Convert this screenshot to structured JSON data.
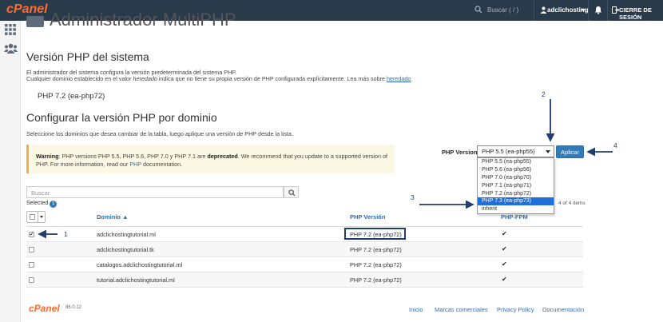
{
  "topbar": {
    "logo": "cPanel",
    "search_placeholder": "Buscar ( / )",
    "user": "adclichosting",
    "logout": "CIERRE DE SESIÓN"
  },
  "page": {
    "title": "Administrador MultiPHP"
  },
  "system_section": {
    "heading": "Versión PHP del sistema",
    "desc_line1": "El administrador del sistema configura la versión predeterminada del sistema PHP.",
    "desc_line2_prefix": "Cualquier dominio establecido en el valor ",
    "desc_line2_em": "heredado",
    "desc_line2_suffix": " indica que no tiene su propia versión de PHP configurada explícitamente. Lea más sobre ",
    "desc_link": "heredado",
    "current_version": "PHP 7.2 (ea-php72)"
  },
  "domain_section": {
    "heading": "Configurar la versión PHP por dominio",
    "desc": "Seleccione los dominios que desea cambiar de la tabla, luego aplique una versión de PHP desde la lista."
  },
  "warning": {
    "bold_lead": "Warning",
    "text1": ": PHP versions PHP 5.5, PHP 5.6, PHP 7.0 y PHP 7.1 are ",
    "bold_deprecated": "deprecated",
    "text2": ". We recommend that you update to a supported version of",
    "line2_a": "PHP. For more information, read our ",
    "link": "PHP",
    "line2_b": " documentation."
  },
  "php_control": {
    "label": "PHP Version",
    "selected": "PHP 5.5 (ea-php55)",
    "apply_label": "Aplicar",
    "options": [
      "PHP 5.5 (ea-php55)",
      "PHP 5.6 (ea-php56)",
      "PHP 7.0 (ea-php70)",
      "PHP 7.1 (ea-php71)",
      "PHP 7.2 (ea-php72)",
      "PHP 7.3 (ea-php73)",
      "inherit"
    ],
    "highlighted_option": "PHP 7.3 (ea-php73)"
  },
  "table_tools": {
    "search_placeholder": "Buscar",
    "selected_label": "Selected",
    "selected_count": "1",
    "items_label": "4 of 4 items"
  },
  "table": {
    "columns": [
      "Dominio ▲",
      "PHP Versión",
      "PHP-FPM"
    ],
    "rows": [
      {
        "domain": "adclichostingtutorial.ml",
        "php": "PHP 7.2 (ea-php72)",
        "fpm": "✔",
        "checked": true
      },
      {
        "domain": "adclichostingtutorial.tk",
        "php": "PHP 7.2 (ea-php72)",
        "fpm": "✔",
        "checked": false
      },
      {
        "domain": "catalogos.adclichostingtutorial.ml",
        "php": "PHP 7.2 (ea-php72)",
        "fpm": "✔",
        "checked": false
      },
      {
        "domain": "tutorial.adclichostingtutorial.ml",
        "php": "PHP 7.2 (ea-php72)",
        "fpm": "✔",
        "checked": false
      }
    ]
  },
  "annotations": {
    "n1": "1",
    "n2": "2",
    "n3": "3",
    "n4": "4"
  },
  "footer": {
    "logo": "cPanel",
    "version": "86.0.12",
    "links": [
      "Inicio",
      "Marcas comerciales",
      "Privacy Policy",
      "Documentación"
    ]
  },
  "colors": {
    "topbar": "#293a4a",
    "brand": "#ff6c2c",
    "link": "#2a6dbf",
    "primary": "#337ab7",
    "annotation": "#1f3d6e",
    "dropdown_selected": "#1e6fd9"
  },
  "icons": [
    "search-icon",
    "user-icon",
    "bell-icon",
    "logout-icon",
    "grid-icon",
    "users-icon",
    "check-icon"
  ]
}
